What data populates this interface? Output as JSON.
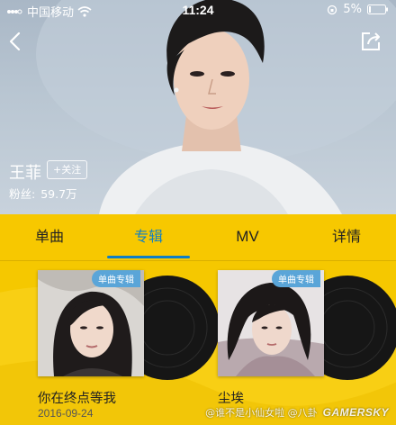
{
  "status_bar": {
    "carrier": "中国移动",
    "time": "11:24",
    "battery": "5%"
  },
  "artist": {
    "name": "王菲",
    "follow_label": "关注",
    "fans_label": "粉丝:",
    "fans_count": "59.7万"
  },
  "tabs": [
    {
      "label": "单曲",
      "active": false
    },
    {
      "label": "专辑",
      "active": true
    },
    {
      "label": "MV",
      "active": false
    },
    {
      "label": "详情",
      "active": false
    }
  ],
  "albums": [
    {
      "title": "你在终点等我",
      "date": "2016-09-24",
      "badge": "单曲专辑"
    },
    {
      "title": "尘埃",
      "date": "",
      "badge": "单曲专辑"
    }
  ],
  "watermark": {
    "text": "@谁不是小仙女啦 @八卦",
    "logo": "GAMERSKY"
  },
  "colors": {
    "accent": "#0f7fc6",
    "tab_bg": "#f7c800",
    "badge": "#5aa5d8"
  }
}
